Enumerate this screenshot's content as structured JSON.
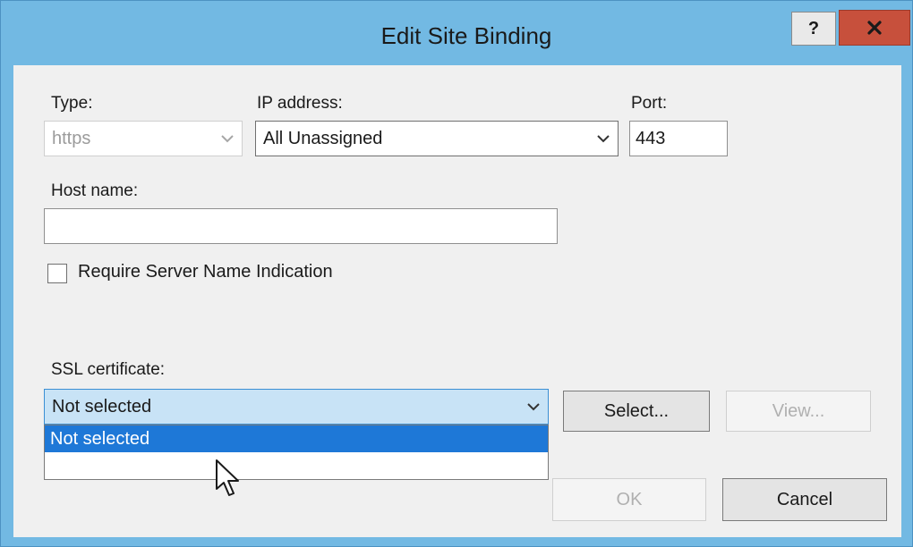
{
  "dialog": {
    "title": "Edit Site Binding",
    "help_label": "?"
  },
  "type": {
    "label": "Type:",
    "value": "https"
  },
  "ip_address": {
    "label": "IP address:",
    "value": "All Unassigned"
  },
  "port": {
    "label": "Port:",
    "value": "443"
  },
  "host_name": {
    "label": "Host name:",
    "value": ""
  },
  "sni": {
    "label": "Require Server Name Indication",
    "checked": false
  },
  "ssl": {
    "label": "SSL certificate:",
    "value": "Not selected",
    "options": [
      "Not selected",
      ""
    ],
    "selected_index": 0
  },
  "buttons": {
    "select": "Select...",
    "view": "View...",
    "ok": "OK",
    "cancel": "Cancel"
  },
  "colors": {
    "title_bar": "#72b9e3",
    "close_button": "#c7503c",
    "selection": "#1e78d7"
  },
  "icons": [
    "help-icon",
    "close-icon",
    "chevron-down-icon",
    "mouse-cursor-icon"
  ]
}
